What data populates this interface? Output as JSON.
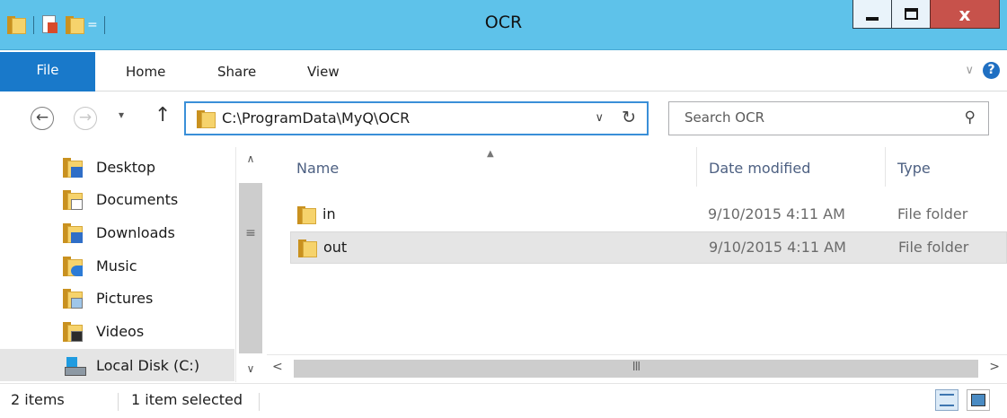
{
  "window": {
    "title": "OCR",
    "close_label": "x",
    "colors": {
      "titlebar": "#5ec2ea",
      "file_tab": "#1979ca",
      "close_button": "#c7524b",
      "address_border": "#3a8fd8"
    }
  },
  "qat": {
    "dropdown_glyph": "="
  },
  "ribbon": {
    "file_tab": "File",
    "tabs": [
      "Home",
      "Share",
      "View"
    ],
    "help_label": "?"
  },
  "navigation": {
    "back_glyph": "←",
    "forward_glyph": "→",
    "recent_glyph": "▾",
    "up_glyph": "↑",
    "address_path": "C:\\ProgramData\\MyQ\\OCR",
    "address_dropdown_glyph": "∨",
    "refresh_glyph": "↻",
    "search_placeholder": "Search OCR"
  },
  "tree": {
    "items": [
      {
        "label": "Desktop",
        "icon": "desktop-folder-icon"
      },
      {
        "label": "Documents",
        "icon": "documents-folder-icon"
      },
      {
        "label": "Downloads",
        "icon": "downloads-folder-icon"
      },
      {
        "label": "Music",
        "icon": "music-folder-icon"
      },
      {
        "label": "Pictures",
        "icon": "pictures-folder-icon"
      },
      {
        "label": "Videos",
        "icon": "videos-folder-icon"
      },
      {
        "label": "Local Disk (C:)",
        "icon": "local-disk-icon",
        "selected": true
      }
    ]
  },
  "file_list": {
    "columns": [
      "Name",
      "Date modified",
      "Type"
    ],
    "rows": [
      {
        "name": "in",
        "date_modified": "9/10/2015 4:11 AM",
        "type": "File folder",
        "selected": false
      },
      {
        "name": "out",
        "date_modified": "9/10/2015 4:11 AM",
        "type": "File folder",
        "selected": true
      }
    ]
  },
  "hscroll": {
    "grip_glyph": "III"
  },
  "status_bar": {
    "item_count": "2 items",
    "selection": "1 item selected"
  }
}
